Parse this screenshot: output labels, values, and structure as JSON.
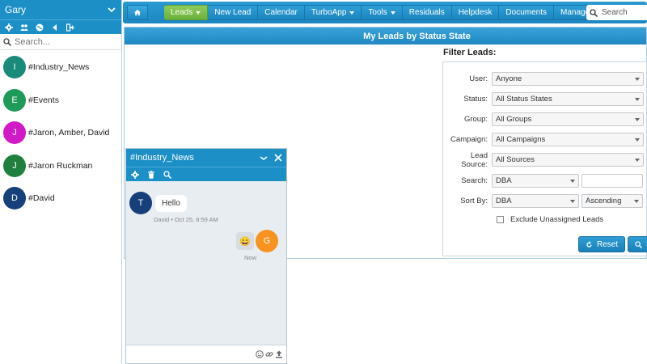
{
  "sidebar": {
    "user_name": "Gary",
    "search_placeholder": "Search...",
    "conversations": [
      {
        "initial": "I",
        "name": "#Industry_News",
        "color": "#1a8a7a"
      },
      {
        "initial": "E",
        "name": "#Events",
        "color": "#1e9a5a"
      },
      {
        "initial": "J",
        "name": "#Jaron, Amber, David",
        "color": "#d119c8"
      },
      {
        "initial": "J",
        "name": "#Jaron Ruckman",
        "color": "#1e7f3e"
      },
      {
        "initial": "D",
        "name": "#David",
        "color": "#173f7a"
      }
    ]
  },
  "nav": {
    "items": [
      "Leads",
      "New Lead",
      "Calendar",
      "TurboApp",
      "Tools",
      "Residuals",
      "Helpdesk",
      "Documents",
      "Manage"
    ],
    "search_placeholder": "Search"
  },
  "panel": {
    "title": "My Leads by Status State"
  },
  "filter": {
    "title": "Filter Leads:",
    "user_label": "User:",
    "user_value": "Anyone",
    "status_label": "Status:",
    "status_value": "All Status States",
    "group_label": "Group:",
    "group_value": "All Groups",
    "campaign_label": "Campaign:",
    "campaign_value": "All Campaigns",
    "source_label": "Lead Source:",
    "source_value": "All Sources",
    "search_label": "Search:",
    "search_field": "DBA",
    "sort_label": "Sort By:",
    "sort_field": "DBA",
    "sort_order": "Ascending",
    "exclude_label": "Exclude Unassigned Leads",
    "reset_label": "Reset",
    "search_button_label": "S"
  },
  "chat": {
    "title": "#Industry_News",
    "incoming": {
      "initial": "T",
      "text": "Hello",
      "meta": "David • Oct 25, 8:59 AM",
      "color": "#173f7a"
    },
    "outgoing": {
      "initial": "G",
      "text": "😄",
      "meta": "Now",
      "color": "#f7931e"
    }
  }
}
